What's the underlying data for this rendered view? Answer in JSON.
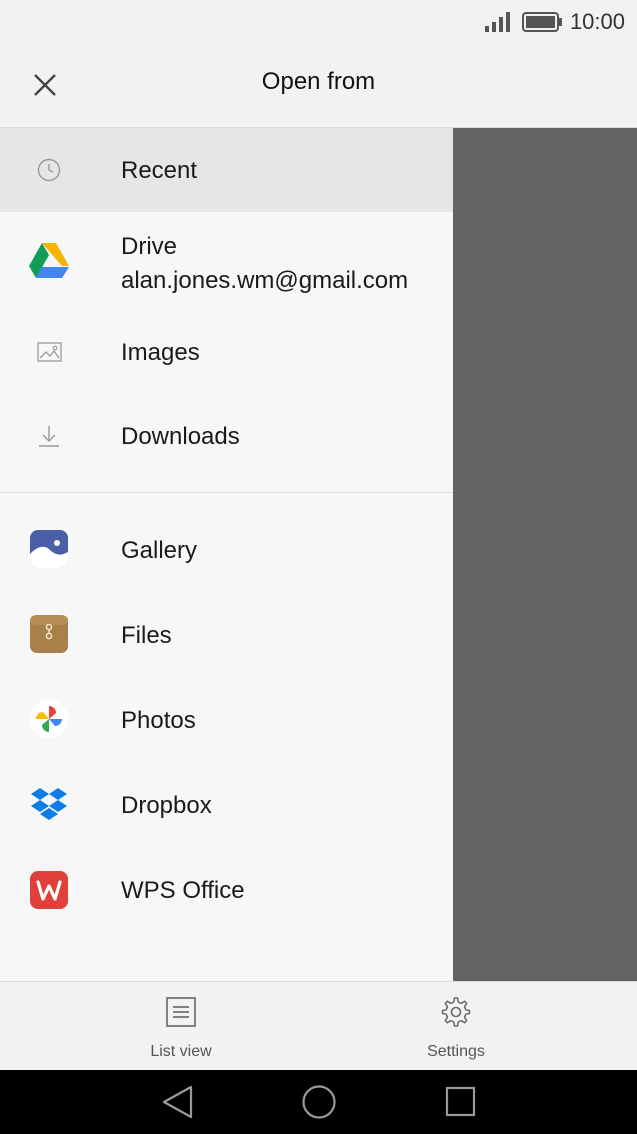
{
  "status_bar": {
    "time": "10:00"
  },
  "header": {
    "title": "Open from"
  },
  "drawer": {
    "items": [
      {
        "label": "Recent",
        "icon": "clock-icon",
        "selected": true
      },
      {
        "label": "Drive",
        "sublabel": "alan.jones.wm@gmail.com",
        "icon": "google-drive-icon"
      },
      {
        "label": "Images",
        "icon": "image-icon"
      },
      {
        "label": "Downloads",
        "icon": "download-icon"
      },
      {
        "label": "Gallery",
        "icon": "gallery-app-icon"
      },
      {
        "label": "Files",
        "icon": "files-app-icon"
      },
      {
        "label": "Photos",
        "icon": "google-photos-icon"
      },
      {
        "label": "Dropbox",
        "icon": "dropbox-icon"
      },
      {
        "label": "WPS Office",
        "icon": "wps-office-icon"
      }
    ]
  },
  "bottom_bar": {
    "list_view_label": "List view",
    "settings_label": "Settings"
  },
  "colors": {
    "scrim": "#646464",
    "selected_row": "#e6e6e6",
    "drive_green": "#0f9d58",
    "drive_yellow": "#f4b400",
    "drive_blue": "#4285f4",
    "dropbox_blue": "#0d7ee8",
    "wps_red": "#e0403b",
    "gallery_blue": "#4a5fa5",
    "files_brown": "#a8804a"
  }
}
